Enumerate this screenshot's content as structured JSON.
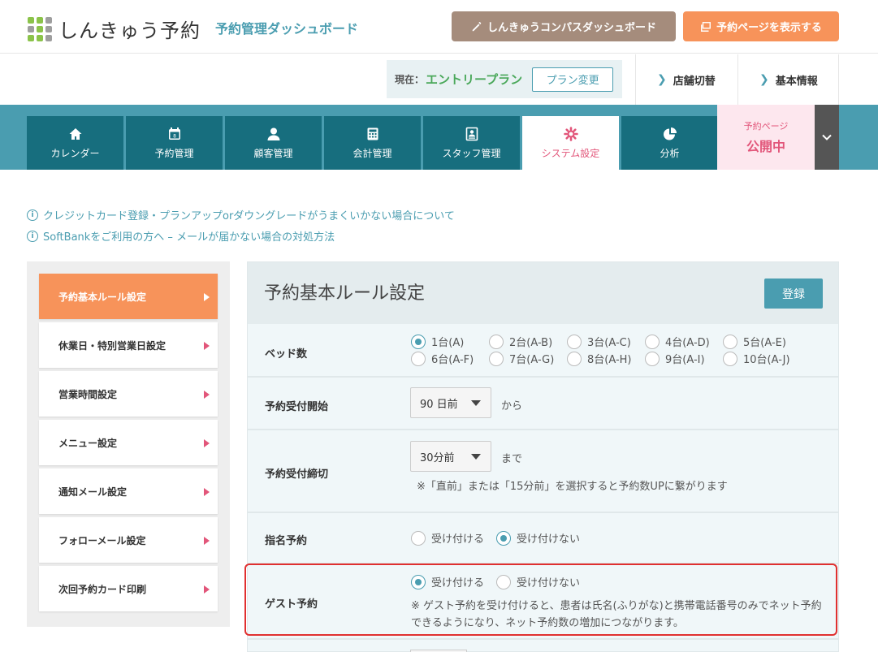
{
  "header": {
    "logo_text": "しんきゅう予約",
    "logo_colors": [
      "#8bc34a",
      "#8bc34a",
      "#9e9e9e",
      "#9e9e9e",
      "#8bc34a",
      "#9e9e9e",
      "#8bc34a",
      "#8bc34a",
      "#9e9e9e"
    ],
    "subtitle": "予約管理ダッシュボード",
    "compass_button": "しんきゅうコンパスダッシュボード",
    "view_page_button": "予約ページを表示する"
  },
  "subbar": {
    "plan_label": "現在：",
    "plan_name": "エントリープラン",
    "plan_change": "プラン変更",
    "store_switch": "店舗切替",
    "basic_info": "基本情報"
  },
  "nav": {
    "tabs": [
      {
        "label": "カレンダー",
        "icon": "home-icon"
      },
      {
        "label": "予約管理",
        "icon": "calendar-icon",
        "calendar_day": "8"
      },
      {
        "label": "顧客管理",
        "icon": "user-icon"
      },
      {
        "label": "会計管理",
        "icon": "calculator-icon"
      },
      {
        "label": "スタッフ管理",
        "icon": "id-card-icon"
      },
      {
        "label": "システム設定",
        "icon": "gear-icon"
      },
      {
        "label": "分析",
        "icon": "pie-chart-icon"
      }
    ],
    "active_tab": "システム設定",
    "publish_small": "予約ページ",
    "publish_big": "公開中"
  },
  "info_links": [
    "クレジットカード登録・プランアップorダウングレードがうまくいかない場合について",
    "SoftBankをご利用の方へ – メールが届かない場合の対処方法"
  ],
  "info_icon_glyph": "i",
  "sidemenu": {
    "items": [
      "予約基本ルール設定",
      "休業日・特別営業日設定",
      "営業時間設定",
      "メニュー設定",
      "通知メール設定",
      "フォローメール設定",
      "次回予約カード印刷"
    ],
    "active": "予約基本ルール設定"
  },
  "panel": {
    "title": "予約基本ルール設定",
    "register_button": "登録",
    "beds": {
      "label": "ベッド数",
      "options": [
        "1台(A)",
        "2台(A-B)",
        "3台(A-C)",
        "4台(A-D)",
        "5台(A-E)",
        "6台(A-F)",
        "7台(A-G)",
        "8台(A-H)",
        "9台(A-I)",
        "10台(A-J)"
      ],
      "selected": "1台(A)"
    },
    "start": {
      "label": "予約受付開始",
      "value": "90 日前",
      "suffix": "から"
    },
    "deadline": {
      "label": "予約受付締切",
      "value": "30分前",
      "suffix": "まで",
      "note": "※「直前」または「15分前」を選択すると予約数UPに繋がります"
    },
    "nominated": {
      "label": "指名予約",
      "options": [
        "受け付ける",
        "受け付けない"
      ],
      "selected": "受け付けない"
    },
    "guest": {
      "label": "ゲスト予約",
      "options": [
        "受け付ける",
        "受け付けない"
      ],
      "selected": "受け付ける",
      "note_line1": "※ ゲスト予約を受け付けると、患者は氏名(ふりがな)と携帯電話番号のみでネット予約",
      "note_line2": "できるようになり、ネット予約数の増加につながります。"
    }
  },
  "colors": {
    "teal": "#4a9db0",
    "dark_teal": "#176e7e",
    "orange": "#f7935a",
    "brown": "#a58c7c",
    "pink": "#e2567a",
    "highlight_red": "#e03030"
  }
}
